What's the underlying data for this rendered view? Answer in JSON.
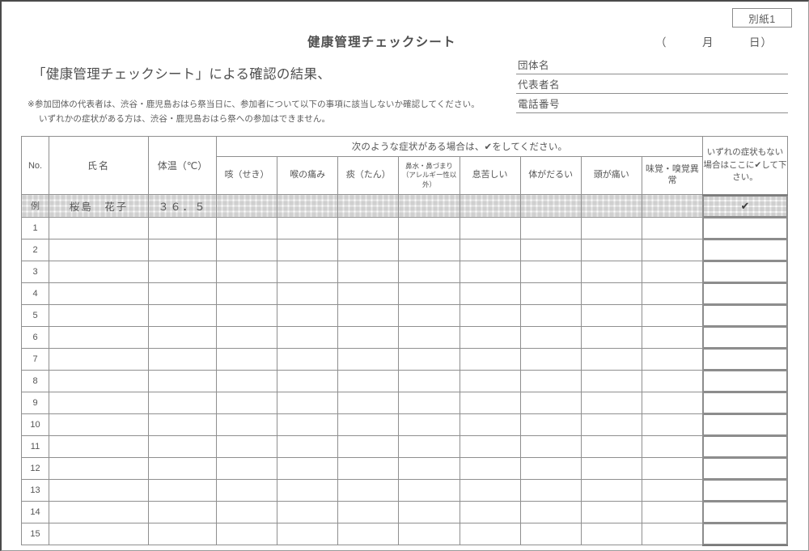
{
  "document": {
    "reference_label": "別紙1",
    "title": "健康管理チェックシート",
    "date_field": "（　　　月　　　日）",
    "subtitle": "「健康管理チェックシート」による確認の結果、",
    "notes": [
      "※参加団体の代表者は、渋谷・鹿児島おはら祭当日に、参加者について以下の事項に該当しないか確認してください。",
      "いずれかの症状がある方は、渋谷・鹿児島おはら祭への参加はできません。"
    ]
  },
  "form_fields": [
    {
      "label": "団体名",
      "value": ""
    },
    {
      "label": "代表者名",
      "value": ""
    },
    {
      "label": "電話番号",
      "value": ""
    }
  ],
  "table": {
    "headers": {
      "no": "No.",
      "name": "氏名",
      "temperature": "体温（℃）",
      "symptom_group": "次のような症状がある場合は、✔をしてください。",
      "no_symptoms": "いずれの症状もない場合はここに✔して下さい。"
    },
    "symptom_columns": [
      {
        "label": "咳（せき）",
        "small": false
      },
      {
        "label": "喉の痛み",
        "small": false
      },
      {
        "label": "痰（たん）",
        "small": false
      },
      {
        "label": "鼻水・鼻づまり（アレルギー性以外）",
        "small": true
      },
      {
        "label": "息苦しい",
        "small": false
      },
      {
        "label": "体がだるい",
        "small": false
      },
      {
        "label": "頭が痛い",
        "small": false
      },
      {
        "label": "味覚・嗅覚異常",
        "small": false
      }
    ],
    "example_row": {
      "no": "例",
      "name": "桜島　花子",
      "temperature": "３６．５",
      "symptoms": [
        "",
        "",
        "",
        "",
        "",
        "",
        "",
        ""
      ],
      "no_symptoms_check": "✔"
    },
    "rows": [
      {
        "no": "1",
        "name": "",
        "temperature": "",
        "symptoms": [
          "",
          "",
          "",
          "",
          "",
          "",
          "",
          ""
        ],
        "no_symptoms_check": ""
      },
      {
        "no": "2",
        "name": "",
        "temperature": "",
        "symptoms": [
          "",
          "",
          "",
          "",
          "",
          "",
          "",
          ""
        ],
        "no_symptoms_check": ""
      },
      {
        "no": "3",
        "name": "",
        "temperature": "",
        "symptoms": [
          "",
          "",
          "",
          "",
          "",
          "",
          "",
          ""
        ],
        "no_symptoms_check": ""
      },
      {
        "no": "4",
        "name": "",
        "temperature": "",
        "symptoms": [
          "",
          "",
          "",
          "",
          "",
          "",
          "",
          ""
        ],
        "no_symptoms_check": ""
      },
      {
        "no": "5",
        "name": "",
        "temperature": "",
        "symptoms": [
          "",
          "",
          "",
          "",
          "",
          "",
          "",
          ""
        ],
        "no_symptoms_check": ""
      },
      {
        "no": "6",
        "name": "",
        "temperature": "",
        "symptoms": [
          "",
          "",
          "",
          "",
          "",
          "",
          "",
          ""
        ],
        "no_symptoms_check": ""
      },
      {
        "no": "7",
        "name": "",
        "temperature": "",
        "symptoms": [
          "",
          "",
          "",
          "",
          "",
          "",
          "",
          ""
        ],
        "no_symptoms_check": ""
      },
      {
        "no": "8",
        "name": "",
        "temperature": "",
        "symptoms": [
          "",
          "",
          "",
          "",
          "",
          "",
          "",
          ""
        ],
        "no_symptoms_check": ""
      },
      {
        "no": "9",
        "name": "",
        "temperature": "",
        "symptoms": [
          "",
          "",
          "",
          "",
          "",
          "",
          "",
          ""
        ],
        "no_symptoms_check": ""
      },
      {
        "no": "10",
        "name": "",
        "temperature": "",
        "symptoms": [
          "",
          "",
          "",
          "",
          "",
          "",
          "",
          ""
        ],
        "no_symptoms_check": ""
      },
      {
        "no": "11",
        "name": "",
        "temperature": "",
        "symptoms": [
          "",
          "",
          "",
          "",
          "",
          "",
          "",
          ""
        ],
        "no_symptoms_check": ""
      },
      {
        "no": "12",
        "name": "",
        "temperature": "",
        "symptoms": [
          "",
          "",
          "",
          "",
          "",
          "",
          "",
          ""
        ],
        "no_symptoms_check": ""
      },
      {
        "no": "13",
        "name": "",
        "temperature": "",
        "symptoms": [
          "",
          "",
          "",
          "",
          "",
          "",
          "",
          ""
        ],
        "no_symptoms_check": ""
      },
      {
        "no": "14",
        "name": "",
        "temperature": "",
        "symptoms": [
          "",
          "",
          "",
          "",
          "",
          "",
          "",
          ""
        ],
        "no_symptoms_check": ""
      },
      {
        "no": "15",
        "name": "",
        "temperature": "",
        "symptoms": [
          "",
          "",
          "",
          "",
          "",
          "",
          "",
          ""
        ],
        "no_symptoms_check": ""
      }
    ]
  },
  "colors": {
    "text": "#555555",
    "border": "#8f8f8f",
    "heavy_border": "#7a7a7a",
    "hatch": "#e6e6e6"
  }
}
